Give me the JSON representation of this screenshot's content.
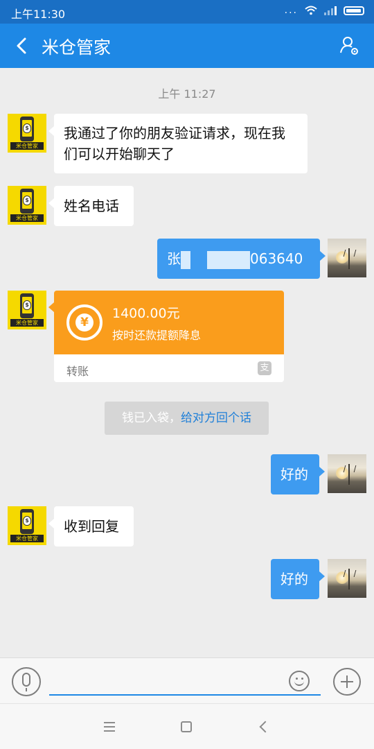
{
  "status_bar": {
    "time": "上午11:30",
    "dots": "...",
    "accent_color": "#1a6fc4"
  },
  "header": {
    "title": "米仓管家",
    "back_icon": "back-arrow-icon",
    "profile_icon": "user-settings-icon",
    "color": "#1e88e5"
  },
  "chat": {
    "timestamp": "上午 11:27",
    "bot_avatar_brand": "米仓管家",
    "messages": [
      {
        "side": "left",
        "text": "我通过了你的朋友验证请求，现在我们可以开始聊天了"
      },
      {
        "side": "left",
        "text": "姓名电话"
      },
      {
        "side": "right",
        "text_prefix": "张",
        "text_suffix": "063640",
        "note": "partially obscured"
      },
      {
        "side": "left",
        "type": "transfer",
        "amount": "1400.00元",
        "desc": "按时还款提额降息",
        "label": "转账",
        "icon_glyph": "¥",
        "logo_glyph": "支"
      },
      {
        "side": "system",
        "text": "钱已入袋，",
        "link": "给对方回个话"
      },
      {
        "side": "right",
        "text": "好的"
      },
      {
        "side": "left",
        "text": "收到回复"
      },
      {
        "side": "right",
        "text": "好的"
      }
    ]
  },
  "input_bar": {
    "value": "",
    "placeholder": ""
  }
}
